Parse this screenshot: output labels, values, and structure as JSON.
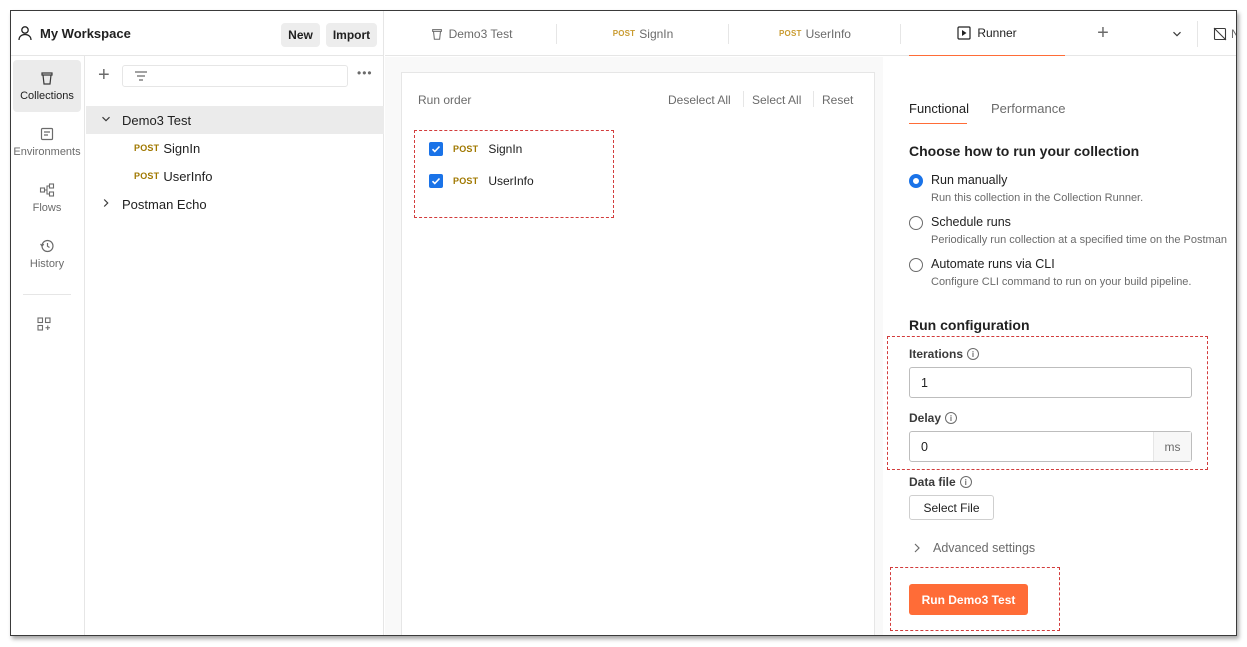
{
  "workspace": {
    "title": "My Workspace",
    "new_label": "New",
    "import_label": "Import"
  },
  "rail": {
    "items": [
      {
        "label": "Collections",
        "icon": "collections-icon",
        "active": true
      },
      {
        "label": "Environments",
        "icon": "environments-icon"
      },
      {
        "label": "Flows",
        "icon": "flows-icon"
      },
      {
        "label": "History",
        "icon": "history-icon"
      }
    ]
  },
  "tree": {
    "collection": "Demo3 Test",
    "requests": [
      {
        "method": "POST",
        "name": "SignIn"
      },
      {
        "method": "POST",
        "name": "UserInfo"
      }
    ],
    "other_collection": "Postman Echo"
  },
  "tabs": [
    {
      "label": "Demo3 Test"
    },
    {
      "method": "POST",
      "label": "SignIn"
    },
    {
      "method": "POST",
      "label": "UserInfo"
    },
    {
      "label": "Runner",
      "active": true
    }
  ],
  "tabs_extra": {
    "overflow_label": "N"
  },
  "run_order": {
    "label": "Run order",
    "deselect_all": "Deselect All",
    "select_all": "Select All",
    "reset": "Reset",
    "requests": [
      {
        "method": "POST",
        "name": "SignIn",
        "checked": true
      },
      {
        "method": "POST",
        "name": "UserInfo",
        "checked": true
      }
    ]
  },
  "config": {
    "tab_functional": "Functional",
    "tab_performance": "Performance",
    "choose_title": "Choose how to run your collection",
    "options": [
      {
        "label": "Run manually",
        "desc": "Run this collection in the Collection Runner.",
        "selected": true
      },
      {
        "label": "Schedule runs",
        "desc": "Periodically run collection at a specified time on the Postman"
      },
      {
        "label": "Automate runs via CLI",
        "desc": "Configure CLI command to run on your build pipeline."
      }
    ],
    "run_config_title": "Run configuration",
    "iterations_label": "Iterations",
    "iterations_value": "1",
    "delay_label": "Delay",
    "delay_value": "0",
    "delay_unit": "ms",
    "data_file_label": "Data file",
    "select_file": "Select File",
    "advanced": "Advanced settings",
    "run_button": "Run Demo3 Test"
  },
  "colors": {
    "accent": "#ff6c37",
    "checkbox": "#1a73e8",
    "post": "#a07800",
    "annotation": "#d23c3c"
  }
}
